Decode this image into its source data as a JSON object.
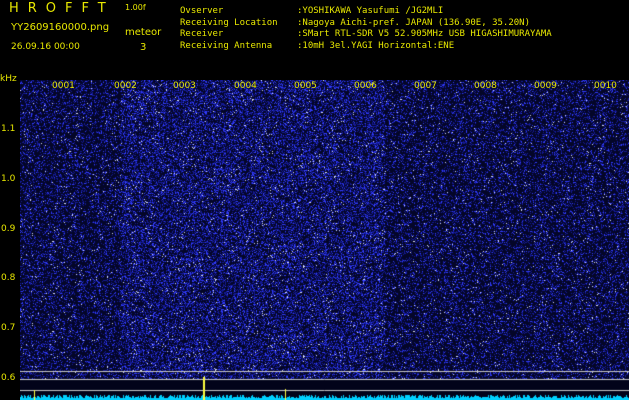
{
  "header": {
    "app_title": "HROFFT",
    "version": "1.00f",
    "file_name": "YY2609160000.png",
    "date_time": "26.09.16 00:00",
    "meteor_label": "meteor",
    "meteor_count": "3"
  },
  "info": {
    "labels": [
      "Ovserver",
      "Receiving Location",
      "Receiver",
      "Receiving Antenna"
    ],
    "values": [
      ":YOSHIKAWA Yasufumi /JG2MLI",
      ":Nagoya Aichi-pref. JAPAN (136.90E, 35.20N)",
      ":SMart RTL-SDR V5 52.905MHz USB HIGASHIMURAYAMA",
      ":10mH 3el.YAGI Horizontal:ENE"
    ]
  },
  "axis": {
    "y_unit": "kHz",
    "y_ticks": [
      "1.1",
      "1.0",
      "0.9",
      "0.8",
      "0.7",
      "0.6"
    ],
    "minute_labels": [
      "0001",
      "0002",
      "0003",
      "0004",
      "0005",
      "0006",
      "0007",
      "0008",
      "0009",
      "0010"
    ]
  },
  "colors": {
    "text": "#e8e800",
    "background": "#000000",
    "noise_bright": "#3c46ff",
    "noise_dim": "#141a8c",
    "baseline": "#00d0ff",
    "guide_line": "#c8c8c8",
    "meteor_trace": "#ffff40"
  }
}
